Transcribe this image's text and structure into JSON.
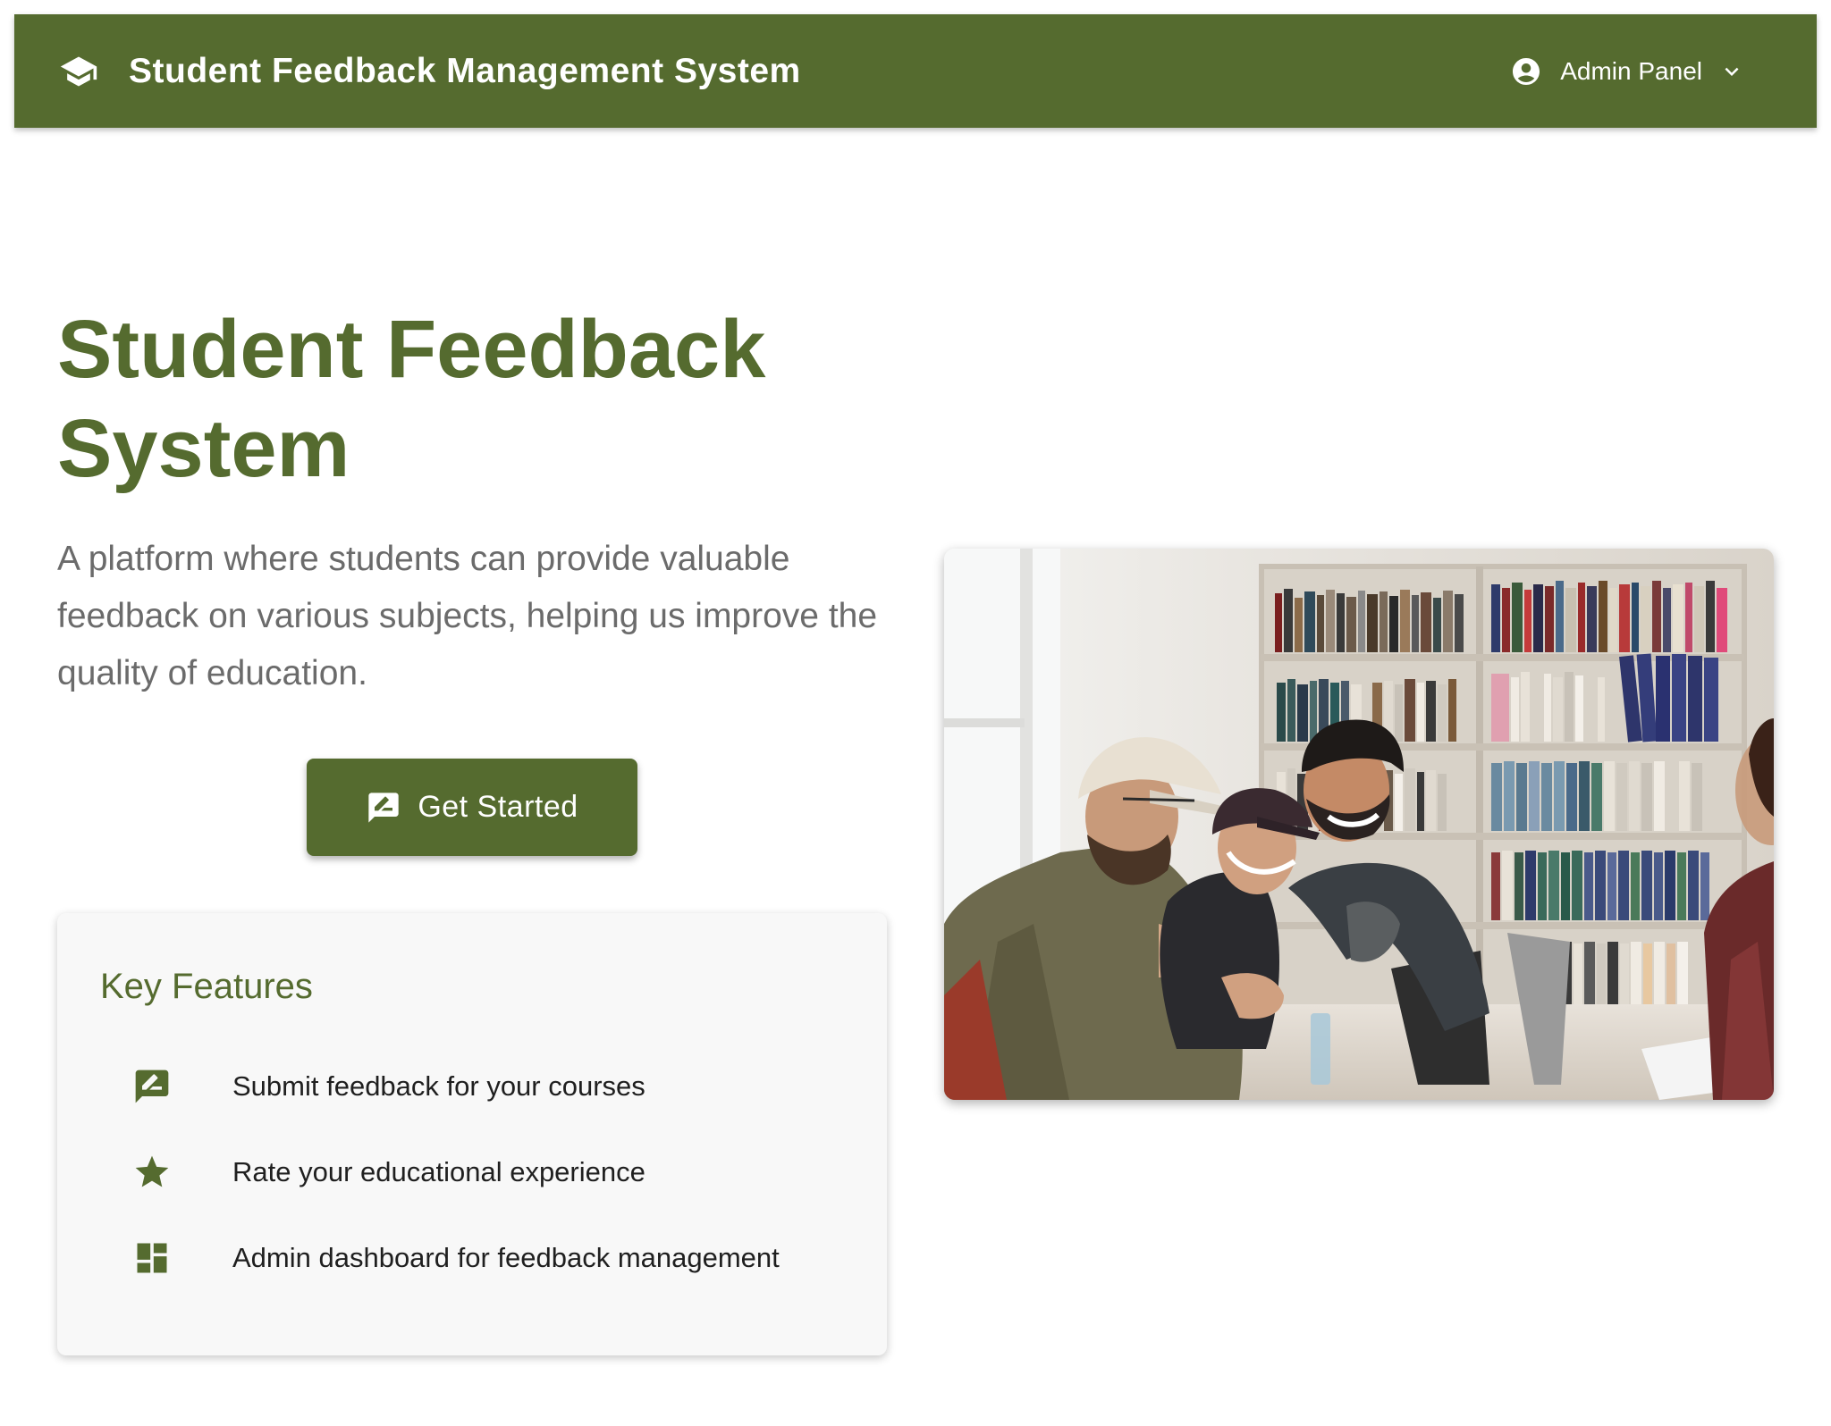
{
  "header": {
    "title": "Student Feedback Management System",
    "brand_icon": "graduation-cap-icon",
    "admin_menu": {
      "label": "Admin Panel",
      "icon": "account-circle-icon",
      "chevron": "chevron-down-icon"
    }
  },
  "hero": {
    "title": "Student Feedback System",
    "description": "A platform where students can provide valuable feedback on various subjects, helping us improve the quality of education.",
    "cta": {
      "label": "Get Started",
      "icon": "feedback-icon"
    }
  },
  "features": {
    "heading": "Key Features",
    "items": [
      {
        "icon": "feedback-icon",
        "text": "Submit feedback for your courses"
      },
      {
        "icon": "star-icon",
        "text": "Rate your educational experience"
      },
      {
        "icon": "dashboard-icon",
        "text": "Admin dashboard for feedback management"
      }
    ]
  },
  "colors": {
    "primary": "#556b2f",
    "card_background": "#f8f8f8",
    "description_text": "#6b6b6b"
  }
}
